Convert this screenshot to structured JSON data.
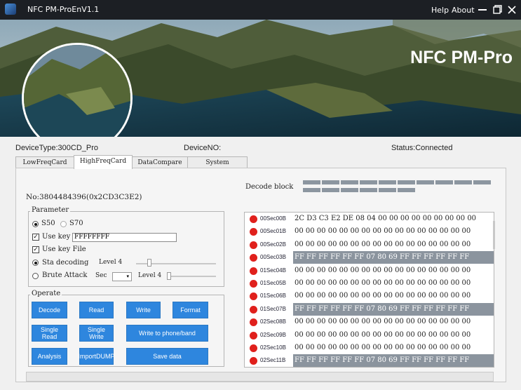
{
  "window": {
    "title": "NFC PM-ProEnV1.1",
    "help_label": "Help",
    "about_label": "About"
  },
  "banner": {
    "title": "NFC PM-Pro"
  },
  "info": {
    "device_type": "DeviceType:300CD_Pro",
    "device_no": "DeviceNO:",
    "status": "Status:Connected"
  },
  "tabs": [
    {
      "label": "LowFreqCard",
      "active": false
    },
    {
      "label": "HighFreqCard",
      "active": true
    },
    {
      "label": "DataCompare",
      "active": false
    },
    {
      "label": "System",
      "active": false
    }
  ],
  "card": {
    "number": "No:3804484396(0x2CD3C3E2)",
    "decode_block_label": "Decode block",
    "decode_progress": {
      "row1_cells": 10,
      "row2_cells": 6
    }
  },
  "parameter": {
    "legend": "Parameter",
    "s50_label": "S50",
    "s70_label": "S70",
    "use_key_label": "Use key",
    "key_value": "FFFFFFFF",
    "use_key_file_label": "Use key File",
    "sta_decoding_label": "Sta decoding",
    "sta_level_label": "Level 4",
    "brute_attack_label": "Brute Attack",
    "sec_label": "Sec",
    "brute_level_label": "Level 4",
    "sta_slider_fraction": 0.15,
    "brute_slider_fraction": 0.0
  },
  "operate": {
    "legend": "Operate",
    "decode": "Decode",
    "read": "Read",
    "write": "Write",
    "format": "Format",
    "single_read": "Single Read",
    "single_write": "Single Write",
    "write_phone": "Write to phone/band",
    "analysis": "Analysis",
    "import_dump": "ImportDUMP",
    "save_data": "Save data"
  },
  "sectors": [
    {
      "label": "00Sec00B",
      "data": "2C D3 C3 E2 DE 08 04 00 00 00 00 00 00 00 00 00",
      "highlight": false
    },
    {
      "label": "00Sec01B",
      "data": "00 00 00 00 00 00 00 00 00 00 00 00 00 00 00 00",
      "highlight": false
    },
    {
      "label": "00Sec02B",
      "data": "00 00 00 00 00 00 00 00 00 00 00 00 00 00 00 00",
      "highlight": false
    },
    {
      "label": "00Sec03B",
      "data": "FF FF FF FF FF FF 07 80 69 FF FF FF FF FF FF",
      "highlight": true
    },
    {
      "label": "01Sec04B",
      "data": "00 00 00 00 00 00 00 00 00 00 00 00 00 00 00 00",
      "highlight": false
    },
    {
      "label": "01Sec05B",
      "data": "00 00 00 00 00 00 00 00 00 00 00 00 00 00 00 00",
      "highlight": false
    },
    {
      "label": "01Sec06B",
      "data": "00 00 00 00 00 00 00 00 00 00 00 00 00 00 00 00",
      "highlight": false
    },
    {
      "label": "01Sec07B",
      "data": "FF FF FF FF FF FF 07 80 69 FF FF FF FF FF FF",
      "highlight": true
    },
    {
      "label": "02Sec08B",
      "data": "00 00 00 00 00 00 00 00 00 00 00 00 00 00 00 00",
      "highlight": false
    },
    {
      "label": "02Sec09B",
      "data": "00 00 00 00 00 00 00 00 00 00 00 00 00 00 00 00",
      "highlight": false
    },
    {
      "label": "02Sec10B",
      "data": "00 00 00 00 00 00 00 00 00 00 00 00 00 00 00 00",
      "highlight": false
    },
    {
      "label": "02Sec11B",
      "data": "FF FF FF FF FF FF 07 80 69 FF FF FF FF FF FF",
      "highlight": true
    }
  ],
  "colors": {
    "accent": "#2e86de",
    "status_dot": "#e0201c",
    "highlight_row": "#8b949e"
  },
  "icons": {
    "app": "app-icon",
    "minimize": "minimize-icon",
    "maximize": "maximize-icon",
    "close": "close-icon"
  }
}
